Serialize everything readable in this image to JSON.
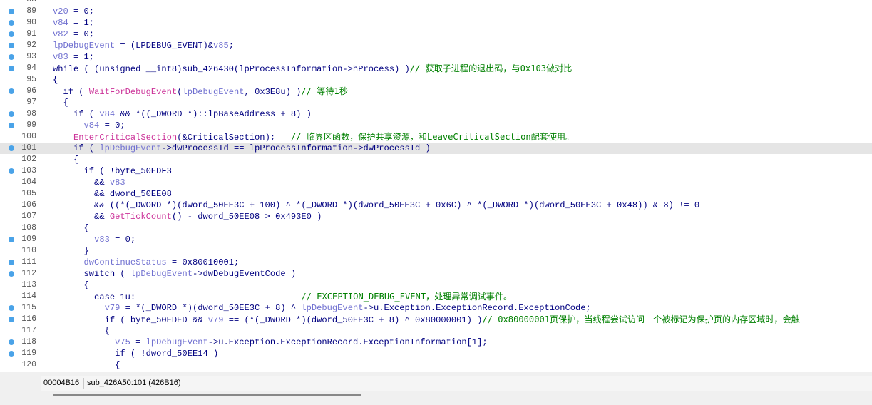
{
  "colors": {
    "breakpoint": "#4aa3e8",
    "highlight": "#e5e5e5",
    "keyword": "#000080",
    "variable": "#7070d0",
    "function": "#cc3399",
    "comment": "#008000"
  },
  "partial_top_line": "88",
  "lines": [
    {
      "num": "89",
      "bp": true,
      "tokens": [
        {
          "t": "v",
          "s": "v20"
        },
        {
          "t": "p",
          "s": " = 0;"
        }
      ]
    },
    {
      "num": "90",
      "bp": true,
      "tokens": [
        {
          "t": "v",
          "s": "v84"
        },
        {
          "t": "p",
          "s": " = 1;"
        }
      ]
    },
    {
      "num": "91",
      "bp": true,
      "tokens": [
        {
          "t": "v",
          "s": "v82"
        },
        {
          "t": "p",
          "s": " = 0;"
        }
      ]
    },
    {
      "num": "92",
      "bp": true,
      "tokens": [
        {
          "t": "v",
          "s": "lpDebugEvent"
        },
        {
          "t": "p",
          "s": " = (LPDEBUG_EVENT)&"
        },
        {
          "t": "v",
          "s": "v85"
        },
        {
          "t": "p",
          "s": ";"
        }
      ]
    },
    {
      "num": "93",
      "bp": true,
      "tokens": [
        {
          "t": "v",
          "s": "v83"
        },
        {
          "t": "p",
          "s": " = 1;"
        }
      ]
    },
    {
      "num": "94",
      "bp": true,
      "tokens": [
        {
          "t": "p",
          "s": "while ( (unsigned __int8)sub_426430(lpProcessInformation->hProcess) )"
        },
        {
          "t": "c",
          "s": "// 获取子进程的退出码，与0x103做对比"
        }
      ]
    },
    {
      "num": "95",
      "bp": false,
      "tokens": [
        {
          "t": "p",
          "s": "{"
        }
      ]
    },
    {
      "num": "96",
      "bp": true,
      "tokens": [
        {
          "t": "p",
          "s": "  if ( "
        },
        {
          "t": "f",
          "s": "WaitForDebugEvent"
        },
        {
          "t": "p",
          "s": "("
        },
        {
          "t": "v",
          "s": "lpDebugEvent"
        },
        {
          "t": "p",
          "s": ", 0x3E8u) )"
        },
        {
          "t": "c",
          "s": "// 等待1秒"
        }
      ]
    },
    {
      "num": "97",
      "bp": false,
      "tokens": [
        {
          "t": "p",
          "s": "  {"
        }
      ]
    },
    {
      "num": "98",
      "bp": true,
      "tokens": [
        {
          "t": "p",
          "s": "    if ( "
        },
        {
          "t": "v",
          "s": "v84"
        },
        {
          "t": "p",
          "s": " && *((_DWORD *)::lpBaseAddress + 8) )"
        }
      ]
    },
    {
      "num": "99",
      "bp": true,
      "tokens": [
        {
          "t": "p",
          "s": "      "
        },
        {
          "t": "v",
          "s": "v84"
        },
        {
          "t": "p",
          "s": " = 0;"
        }
      ]
    },
    {
      "num": "100",
      "bp": false,
      "tokens": [
        {
          "t": "p",
          "s": "    "
        },
        {
          "t": "f",
          "s": "EnterCriticalSection"
        },
        {
          "t": "p",
          "s": "(&CriticalSection);   "
        },
        {
          "t": "c",
          "s": "// 临界区函数，保护共享资源，和LeaveCriticalSection配套使用。"
        }
      ]
    },
    {
      "num": "101",
      "bp": true,
      "hl": true,
      "tokens": [
        {
          "t": "p",
          "s": "    if ( "
        },
        {
          "t": "v",
          "s": "lpDebugEvent"
        },
        {
          "t": "p",
          "s": "->dwProcessId == lpProcessInformation->dwProcessId )"
        }
      ]
    },
    {
      "num": "102",
      "bp": false,
      "tokens": [
        {
          "t": "p",
          "s": "    {"
        }
      ]
    },
    {
      "num": "103",
      "bp": true,
      "tokens": [
        {
          "t": "p",
          "s": "      if ( !byte_50EDF3"
        }
      ]
    },
    {
      "num": "104",
      "bp": false,
      "tokens": [
        {
          "t": "p",
          "s": "        && "
        },
        {
          "t": "v",
          "s": "v83"
        }
      ]
    },
    {
      "num": "105",
      "bp": false,
      "tokens": [
        {
          "t": "p",
          "s": "        && dword_50EE08"
        }
      ]
    },
    {
      "num": "106",
      "bp": false,
      "tokens": [
        {
          "t": "p",
          "s": "        && ((*(_DWORD *)(dword_50EE3C + 100) ^ *(_DWORD *)(dword_50EE3C + 0x6C) ^ *(_DWORD *)(dword_50EE3C + 0x48)) & 8) != 0"
        }
      ]
    },
    {
      "num": "107",
      "bp": false,
      "tokens": [
        {
          "t": "p",
          "s": "        && "
        },
        {
          "t": "f",
          "s": "GetTickCount"
        },
        {
          "t": "p",
          "s": "() - dword_50EE08 > 0x493E0 )"
        }
      ]
    },
    {
      "num": "108",
      "bp": false,
      "tokens": [
        {
          "t": "p",
          "s": "      {"
        }
      ]
    },
    {
      "num": "109",
      "bp": true,
      "tokens": [
        {
          "t": "p",
          "s": "        "
        },
        {
          "t": "v",
          "s": "v83"
        },
        {
          "t": "p",
          "s": " = 0;"
        }
      ]
    },
    {
      "num": "110",
      "bp": false,
      "tokens": [
        {
          "t": "p",
          "s": "      }"
        }
      ]
    },
    {
      "num": "111",
      "bp": true,
      "tokens": [
        {
          "t": "p",
          "s": "      "
        },
        {
          "t": "v",
          "s": "dwContinueStatus"
        },
        {
          "t": "p",
          "s": " = 0x80010001;"
        }
      ]
    },
    {
      "num": "112",
      "bp": true,
      "tokens": [
        {
          "t": "p",
          "s": "      switch ( "
        },
        {
          "t": "v",
          "s": "lpDebugEvent"
        },
        {
          "t": "p",
          "s": "->dwDebugEventCode )"
        }
      ]
    },
    {
      "num": "113",
      "bp": false,
      "tokens": [
        {
          "t": "p",
          "s": "      {"
        }
      ]
    },
    {
      "num": "114",
      "bp": false,
      "tokens": [
        {
          "t": "p",
          "s": "        case 1u:                                "
        },
        {
          "t": "c",
          "s": "// EXCEPTION_DEBUG_EVENT，处理异常调试事件。"
        }
      ]
    },
    {
      "num": "115",
      "bp": true,
      "tokens": [
        {
          "t": "p",
          "s": "          "
        },
        {
          "t": "v",
          "s": "v79"
        },
        {
          "t": "p",
          "s": " = *(_DWORD *)(dword_50EE3C + 8) ^ "
        },
        {
          "t": "v",
          "s": "lpDebugEvent"
        },
        {
          "t": "p",
          "s": "->u.Exception.ExceptionRecord.ExceptionCode;"
        }
      ]
    },
    {
      "num": "116",
      "bp": true,
      "tokens": [
        {
          "t": "p",
          "s": "          if ( byte_50EDED && "
        },
        {
          "t": "v",
          "s": "v79"
        },
        {
          "t": "p",
          "s": " == (*(_DWORD *)(dword_50EE3C + 8) ^ 0x80000001) )"
        },
        {
          "t": "c",
          "s": "// 0x80000001页保护，当线程尝试访问一个被标记为保护页的内存区域时，会触"
        }
      ]
    },
    {
      "num": "117",
      "bp": false,
      "tokens": [
        {
          "t": "p",
          "s": "          {"
        }
      ]
    },
    {
      "num": "118",
      "bp": true,
      "tokens": [
        {
          "t": "p",
          "s": "            "
        },
        {
          "t": "v",
          "s": "v75"
        },
        {
          "t": "p",
          "s": " = "
        },
        {
          "t": "v",
          "s": "lpDebugEvent"
        },
        {
          "t": "p",
          "s": "->u.Exception.ExceptionRecord.ExceptionInformation[1];"
        }
      ]
    },
    {
      "num": "119",
      "bp": true,
      "tokens": [
        {
          "t": "p",
          "s": "            if ( !dword_50EE14 )"
        }
      ]
    },
    {
      "num": "120",
      "bp": false,
      "tokens": [
        {
          "t": "p",
          "s": "            {"
        }
      ]
    }
  ],
  "status": {
    "address": "00004B16",
    "location": "sub_426A50:101 (426B16)"
  }
}
